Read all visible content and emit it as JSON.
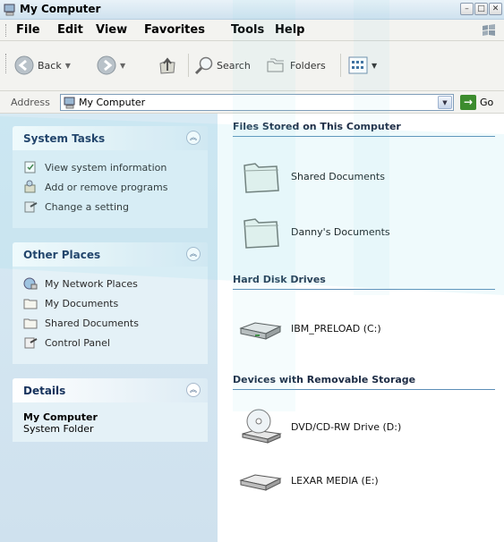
{
  "window": {
    "title": "My Computer",
    "controls": [
      "minimize",
      "maximize",
      "close"
    ]
  },
  "menu": {
    "items": [
      "File",
      "Edit",
      "View",
      "Favorites",
      "Tools",
      "Help"
    ]
  },
  "toolbar": {
    "back_label": "Back",
    "search_label": "Search",
    "folders_label": "Folders"
  },
  "address": {
    "label": "Address",
    "value": "My Computer",
    "go_label": "Go"
  },
  "left_panel": {
    "system_tasks": {
      "title": "System Tasks",
      "items": [
        {
          "label": "View system information",
          "icon": "system-info-icon"
        },
        {
          "label": "Add or remove programs",
          "icon": "add-remove-programs-icon"
        },
        {
          "label": "Change a setting",
          "icon": "control-panel-icon"
        }
      ]
    },
    "other_places": {
      "title": "Other Places",
      "items": [
        {
          "label": "My Network Places",
          "icon": "network-places-icon"
        },
        {
          "label": "My Documents",
          "icon": "folder-icon"
        },
        {
          "label": "Shared Documents",
          "icon": "folder-icon"
        },
        {
          "label": "Control Panel",
          "icon": "control-panel-icon"
        }
      ]
    },
    "details": {
      "title": "Details",
      "name": "My Computer",
      "type": "System Folder"
    }
  },
  "content": {
    "sections": [
      {
        "title": "Files Stored on This Computer",
        "items": [
          {
            "label": "Shared Documents",
            "icon": "folder-icon"
          },
          {
            "label": "Danny's Documents",
            "icon": "folder-icon"
          }
        ]
      },
      {
        "title": "Hard Disk Drives",
        "items": [
          {
            "label": "IBM_PRELOAD (C:)",
            "icon": "hard-disk-icon"
          }
        ]
      },
      {
        "title": "Devices with Removable Storage",
        "items": [
          {
            "label": "DVD/CD-RW Drive (D:)",
            "icon": "dvd-drive-icon"
          },
          {
            "label": "LEXAR MEDIA (E:)",
            "icon": "removable-disk-icon"
          }
        ]
      }
    ]
  },
  "colors": {
    "accent": "#5d8fb8",
    "panel_bg": "#d7eaf4",
    "heading_text": "#16325c"
  }
}
